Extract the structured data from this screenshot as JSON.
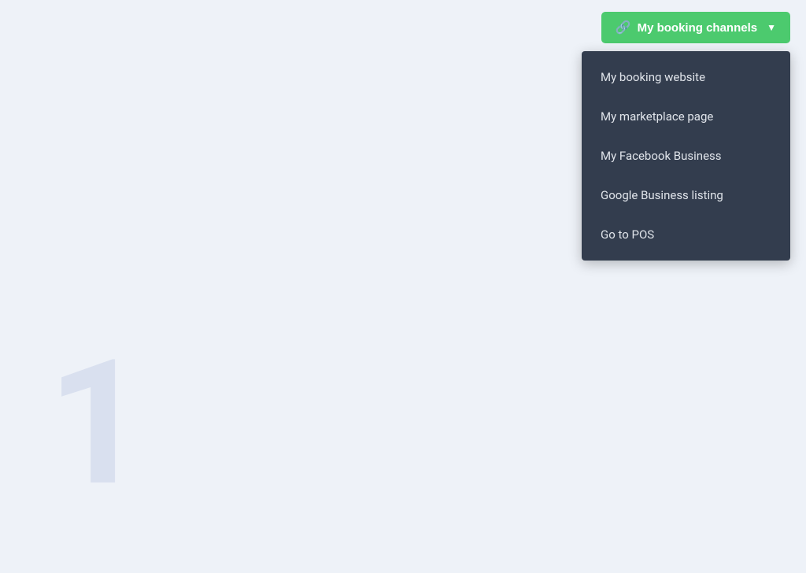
{
  "header": {
    "booking_channels_label": "My booking channels",
    "link_icon": "🔗",
    "chevron_icon": "▼"
  },
  "dropdown": {
    "items": [
      {
        "id": "booking-website",
        "label": "My booking website"
      },
      {
        "id": "marketplace-page",
        "label": "My marketplace page"
      },
      {
        "id": "facebook-business",
        "label": "My Facebook Business"
      },
      {
        "id": "google-business",
        "label": "Google Business listing"
      },
      {
        "id": "go-to-pos",
        "label": "Go to POS"
      }
    ]
  },
  "background": {
    "number": "1"
  },
  "colors": {
    "button_bg": "#4cca6e",
    "dropdown_bg": "#333d4e",
    "page_bg": "#eef2f8"
  }
}
